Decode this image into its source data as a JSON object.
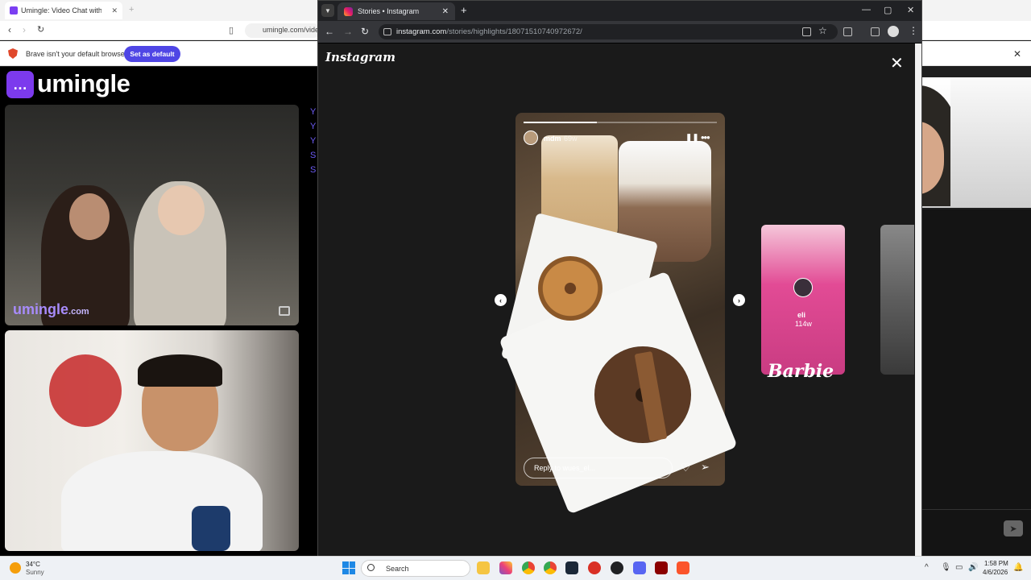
{
  "bg_browser": {
    "tab_title": "Umingle: Video Chat with Str",
    "url": "umingle.com/vide",
    "infobar_text": "Brave isn't your default browser",
    "set_default_label": "Set as default"
  },
  "umingle": {
    "logo_text": "umingle",
    "watermark_main": "umingle",
    "watermark_tld": ".com",
    "chat_letters": [
      "Y",
      "Y",
      "Y",
      "S",
      "S"
    ]
  },
  "chrome": {
    "tab_title": "Stories • Instagram",
    "url_host": "instagram.com",
    "url_path": "/stories/highlights/18071510740972672/"
  },
  "instagram": {
    "logo": "Instagram",
    "story": {
      "username": "mdm",
      "time": "69w",
      "reply_placeholder": "Reply to wues_el...",
      "progress": 0.38
    },
    "next_story": {
      "username": "eli",
      "time": "114w",
      "image_text": "Barbie"
    }
  },
  "taskbar": {
    "temperature": "34°C",
    "weather": "Sunny",
    "search_label": "Search",
    "time": "1:58 PM",
    "date": "4/6/2026"
  },
  "colors": {
    "brave_accent": "#4f46e5",
    "umingle_purple": "#7c3aed",
    "instagram_bg": "#1a1a1a"
  }
}
